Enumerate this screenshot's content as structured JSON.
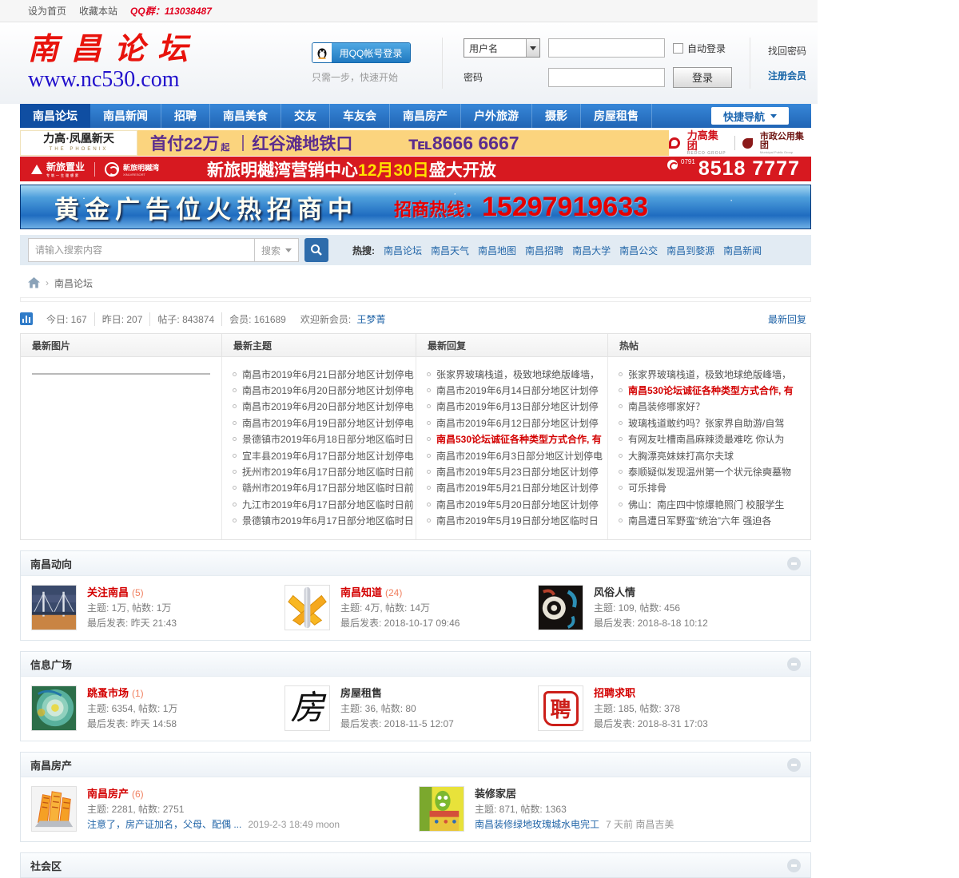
{
  "colors": {
    "nav_blue": "#2e7cc9",
    "active_blue": "#0f4ea2",
    "link_blue": "#2366a8",
    "hot_red": "#d30000",
    "banner2_red": "#d71920",
    "banner1_yellow": "#fbd47e"
  },
  "topbar": {
    "set_home": "设为首页",
    "favorite": "收藏本站",
    "qq_group": "QQ群：113038487"
  },
  "header": {
    "logo_title": "南昌论坛",
    "logo_url": "www.nc530.com",
    "qq_login": "用QQ帐号登录",
    "qq_hint": "只需一步，快速开始",
    "username_label": "用户名",
    "password_label": "密码",
    "auto_login": "自动登录",
    "find_password": "找回密码",
    "login_button": "登录",
    "register": "注册会员"
  },
  "nav": {
    "items": [
      "南昌论坛",
      "南昌新闻",
      "招聘",
      "南昌美食",
      "交友",
      "车友会",
      "南昌房产",
      "户外旅游",
      "摄影",
      "房屋租售"
    ],
    "active_index": 0,
    "quick_nav": "快捷导航"
  },
  "banners": {
    "phoenix": {
      "brand": "力高·凤凰新天",
      "brand_sub": "THE PHOENIX",
      "text1": "首付22万",
      "text1_sup": "起",
      "text2": "红谷滩地铁口",
      "phone": "℡8666 6667",
      "right1": "力高集团",
      "right1_sub": "REDCO GROUP",
      "right2": "市政公用集团",
      "right2_sub": "Municipal Public Group"
    },
    "xinlv": {
      "brand1": "新旅置业",
      "brand1_sub": "专筑一生理想家",
      "brand2": "新旅明樾湾",
      "brand2_sub": "XINLVRESORT",
      "text_pre": "新旅明樾湾营销中心",
      "text_date": "12月30日",
      "text_post": "盛大开放",
      "area_code": "0791",
      "phone": "8518 7777"
    },
    "gold": {
      "text": "黄金广告位火热招商中",
      "hotline_label": "招商热线：",
      "hotline": "15297919633"
    }
  },
  "search": {
    "placeholder": "请输入搜索内容",
    "button": "搜索",
    "hot_label": "热搜:",
    "hot_links": [
      "南昌论坛",
      "南昌天气",
      "南昌地图",
      "南昌招聘",
      "南昌大学",
      "南昌公交",
      "南昌到婺源",
      "南昌新闻"
    ]
  },
  "breadcrumb": {
    "separator": "›",
    "current": "南昌论坛"
  },
  "stats": {
    "items": [
      {
        "label": "今日:",
        "value": "167"
      },
      {
        "label": "昨日:",
        "value": "207"
      },
      {
        "label": "帖子:",
        "value": "843874"
      },
      {
        "label": "会员:",
        "value": "161689"
      }
    ],
    "welcome_label": "欢迎新会员:",
    "newest_member": "王梦菁",
    "latest_reply": "最新回复"
  },
  "board": {
    "headers": [
      "最新图片",
      "最新主题",
      "最新回复",
      "热帖"
    ],
    "latest_topics": [
      {
        "text": "南昌市2019年6月21日部分地区计划停电",
        "hot": false
      },
      {
        "text": "南昌市2019年6月20日部分地区计划停电",
        "hot": false
      },
      {
        "text": "南昌市2019年6月20日部分地区计划停电",
        "hot": false
      },
      {
        "text": "南昌市2019年6月19日部分地区计划停电",
        "hot": false
      },
      {
        "text": "景德镇市2019年6月18日部分地区临时日",
        "hot": false
      },
      {
        "text": "宜丰县2019年6月17日部分地区计划停电",
        "hot": false
      },
      {
        "text": "抚州市2019年6月17日部分地区临时日前",
        "hot": false
      },
      {
        "text": "赣州市2019年6月17日部分地区临时日前",
        "hot": false
      },
      {
        "text": "九江市2019年6月17日部分地区临时日前",
        "hot": false
      },
      {
        "text": "景德镇市2019年6月17日部分地区临时日",
        "hot": false
      }
    ],
    "latest_replies": [
      {
        "text": "张家界玻璃栈道，极致地球绝版峰墙，",
        "hot": false
      },
      {
        "text": "南昌市2019年6月14日部分地区计划停",
        "hot": false
      },
      {
        "text": "南昌市2019年6月13日部分地区计划停",
        "hot": false
      },
      {
        "text": "南昌市2019年6月12日部分地区计划停",
        "hot": false
      },
      {
        "text": "南昌530论坛诚征各种类型方式合作, 有",
        "hot": true
      },
      {
        "text": "南昌市2019年6月3日部分地区计划停电",
        "hot": false
      },
      {
        "text": "南昌市2019年5月23日部分地区计划停",
        "hot": false
      },
      {
        "text": "南昌市2019年5月21日部分地区计划停",
        "hot": false
      },
      {
        "text": "南昌市2019年5月20日部分地区计划停",
        "hot": false
      },
      {
        "text": "南昌市2019年5月19日部分地区临时日",
        "hot": false
      }
    ],
    "hot_posts": [
      {
        "text": "张家界玻璃栈道，极致地球绝版峰墙，",
        "hot": false
      },
      {
        "text": "南昌530论坛诚征各种类型方式合作, 有",
        "hot": true
      },
      {
        "text": "南昌装修哪家好？",
        "hot": false
      },
      {
        "text": "玻璃栈道敢约吗？张家界自助游/自驾",
        "hot": false
      },
      {
        "text": "有网友吐槽南昌麻辣烫最难吃 你认为",
        "hot": false
      },
      {
        "text": "大胸漂亮妹妹打高尔夫球",
        "hot": false
      },
      {
        "text": "泰顺疑似发现温州第一个状元徐奭墓物",
        "hot": false
      },
      {
        "text": "可乐排骨",
        "hot": false
      },
      {
        "text": "佛山：南庄四中惊爆艳照门 校服学生",
        "hot": false
      },
      {
        "text": "南昌遭日军野蛮“统治”六年  强迫各",
        "hot": false
      }
    ]
  },
  "labels": {
    "topics": "主题:",
    "posts": "帖数:",
    "last": "最后发表:",
    "comma": ",  "
  },
  "thumb_glyphs": {
    "fang": "房",
    "seal": "聘"
  },
  "sections": [
    {
      "title": "南昌动向",
      "forums": [
        {
          "name": "关注南昌",
          "count": "(5)",
          "red": true,
          "thumb": "bridge",
          "topics": "1万",
          "posts": "1万",
          "last": "昨天 21:43"
        },
        {
          "name": "南昌知道",
          "count": "(24)",
          "red": true,
          "thumb": "cross",
          "topics": "4万",
          "posts": "14万",
          "last": "2018-10-17 09:46"
        },
        {
          "name": "风俗人情",
          "count": "",
          "red": false,
          "thumb": "mask",
          "topics": "109",
          "posts": "456",
          "last": "2018-8-18 10:12"
        }
      ]
    },
    {
      "title": "信息广场",
      "forums": [
        {
          "name": "跳蚤市场",
          "count": "(1)",
          "red": true,
          "thumb": "disc",
          "topics": "6354",
          "posts": "1万",
          "last": "昨天 14:58"
        },
        {
          "name": "房屋租售",
          "count": "",
          "red": false,
          "thumb": "fang",
          "topics": "36",
          "posts": "80",
          "last": "2018-11-5 12:07"
        },
        {
          "name": "招聘求职",
          "count": "",
          "red": true,
          "thumb": "seal",
          "topics": "185",
          "posts": "378",
          "last": "2018-8-31 17:03"
        }
      ]
    },
    {
      "title": "南昌房产",
      "wide": true,
      "forums": [
        {
          "name": "南昌房产",
          "count": "(6)",
          "red": true,
          "thumb": "towers",
          "topics": "2281",
          "posts": "2751",
          "last_link": "注意了，房产证加名，父母、配偶 ...",
          "last_meta": "2019-2-3 18:49 moon"
        },
        {
          "name": "装修家居",
          "count": "",
          "red": false,
          "thumb": "decor",
          "topics": "871",
          "posts": "1363",
          "last_link": "南昌装修绿地玫瑰城水电完工",
          "last_meta": "7 天前 南昌吉美"
        }
      ]
    },
    {
      "title": "社会区",
      "forums": []
    }
  ]
}
